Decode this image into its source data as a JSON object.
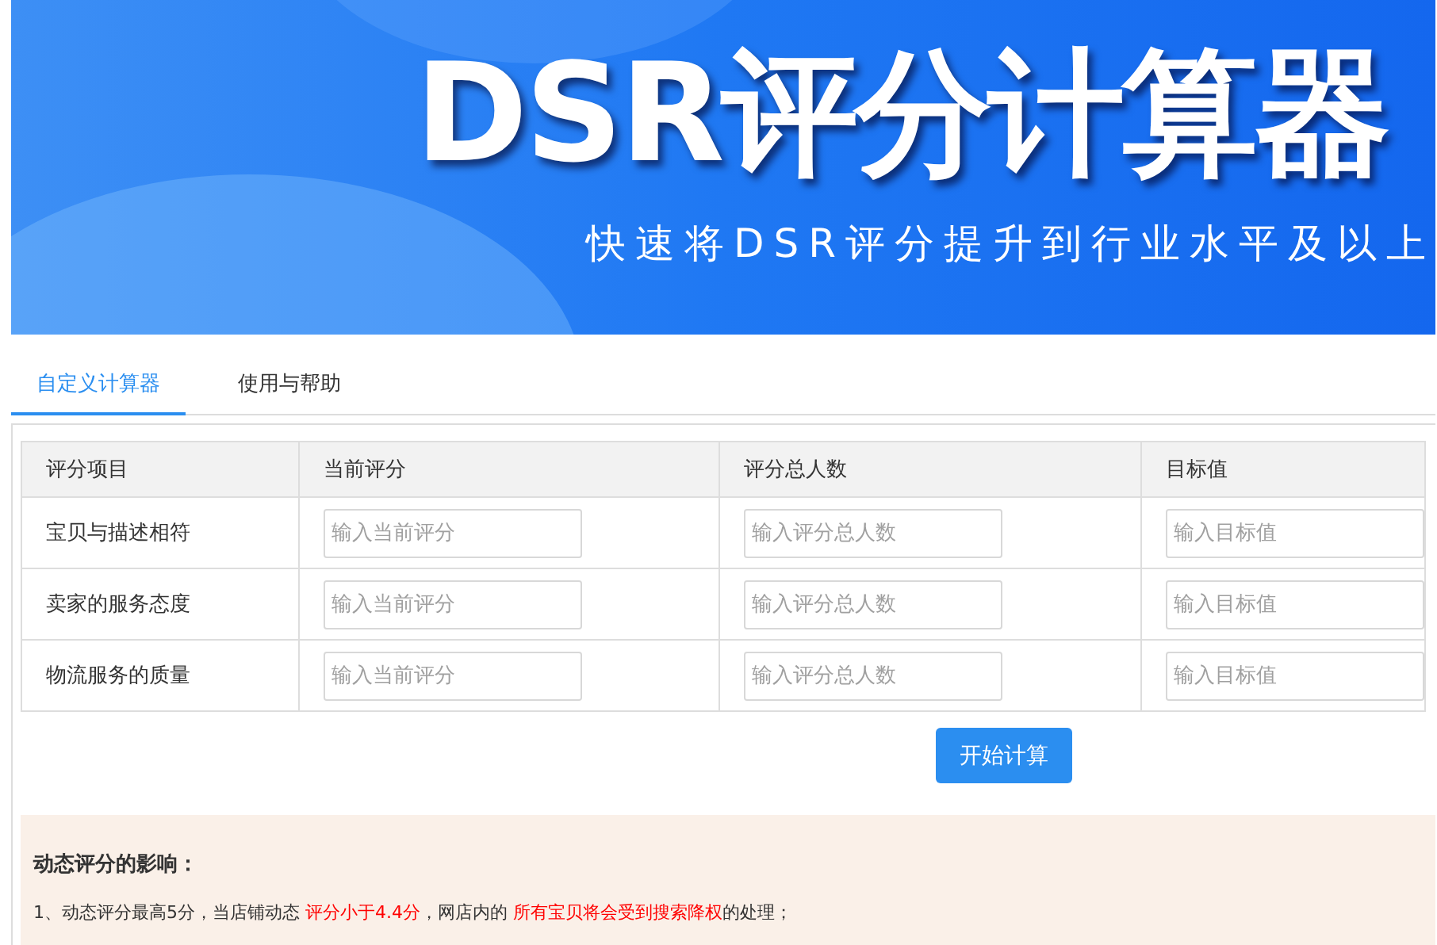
{
  "banner": {
    "title": "DSR评分计算器",
    "subtitle": "快速将DSR评分提升到行业水平及以上"
  },
  "tabs": [
    {
      "label": "自定义计算器",
      "selected": true
    },
    {
      "label": "使用与帮助",
      "selected": false
    }
  ],
  "table": {
    "columns": [
      "评分项目",
      "当前评分",
      "评分总人数",
      "目标值"
    ],
    "rows": [
      {
        "item": "宝贝与描述相符",
        "fields": [
          {
            "placeholder": "输入当前评分"
          },
          {
            "placeholder": "输入评分总人数"
          },
          {
            "placeholder": "输入目标值"
          }
        ]
      },
      {
        "item": "卖家的服务态度",
        "fields": [
          {
            "placeholder": "输入当前评分"
          },
          {
            "placeholder": "输入评分总人数"
          },
          {
            "placeholder": "输入目标值"
          }
        ]
      },
      {
        "item": "物流服务的质量",
        "fields": [
          {
            "placeholder": "输入当前评分"
          },
          {
            "placeholder": "输入评分总人数"
          },
          {
            "placeholder": "输入目标值"
          }
        ]
      }
    ]
  },
  "calculate_button": "开始计算",
  "notes": {
    "heading": "动态评分的影响：",
    "items": [
      [
        {
          "text": "1、动态评分最高5分，当店铺动态 ",
          "highlight": false
        },
        {
          "text": "评分小于4.4分",
          "highlight": true
        },
        {
          "text": "，网店内的 ",
          "highlight": false
        },
        {
          "text": "所有宝贝将会受到搜索降权",
          "highlight": true
        },
        {
          "text": "的处理；",
          "highlight": false
        }
      ]
    ]
  }
}
